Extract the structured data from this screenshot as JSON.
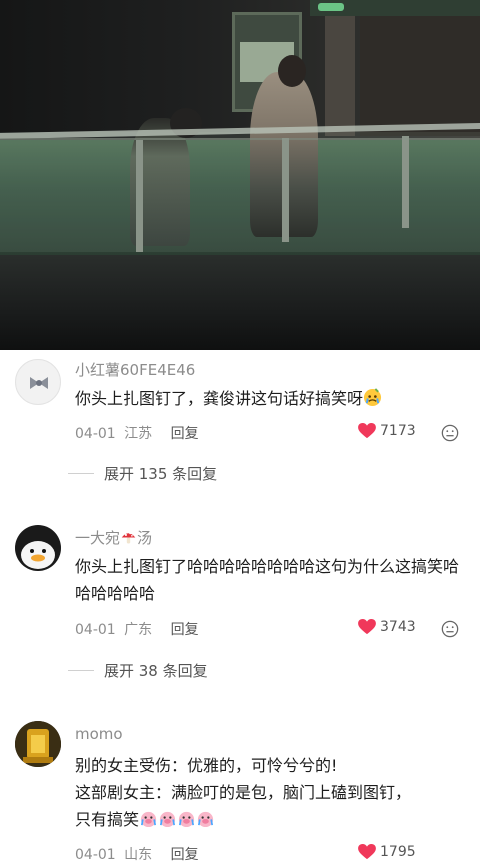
{
  "comments": [
    {
      "username": "小红薯60FE4E46",
      "text": "你头上扎图钉了，龚俊讲这句话好搞笑呀",
      "date": "04-01",
      "location": "江苏",
      "reply_label": "回复",
      "likes": "7173",
      "expand_label": "展开 135 条回复"
    },
    {
      "username_prefix": "一大宛",
      "username_suffix": "汤",
      "text": "你头上扎图钉了哈哈哈哈哈哈哈哈这句为什么这搞笑哈哈哈哈哈哈",
      "date": "04-01",
      "location": "广东",
      "reply_label": "回复",
      "likes": "3743",
      "expand_label": "展开 38 条回复"
    },
    {
      "username": "momo",
      "line1": "别的女主受伤：优雅的，可怜兮兮的!",
      "line2": "这部剧女主：满脸叮的是包，脑门上磕到图钉，",
      "line3": "只有搞笑",
      "date": "04-01",
      "location": "山东",
      "reply_label": "回复",
      "likes": "1795"
    }
  ],
  "colors": {
    "heart": "#f0385a",
    "meta_text": "#8c8c8c",
    "body_text": "#1d1d1d"
  },
  "icons": [
    "bow-avatar-icon",
    "duck-avatar-icon",
    "golden-avatar-icon",
    "heart-icon",
    "dislike-face-icon",
    "mushroom-icon",
    "crying-face-icon",
    "pig-face-icon"
  ]
}
